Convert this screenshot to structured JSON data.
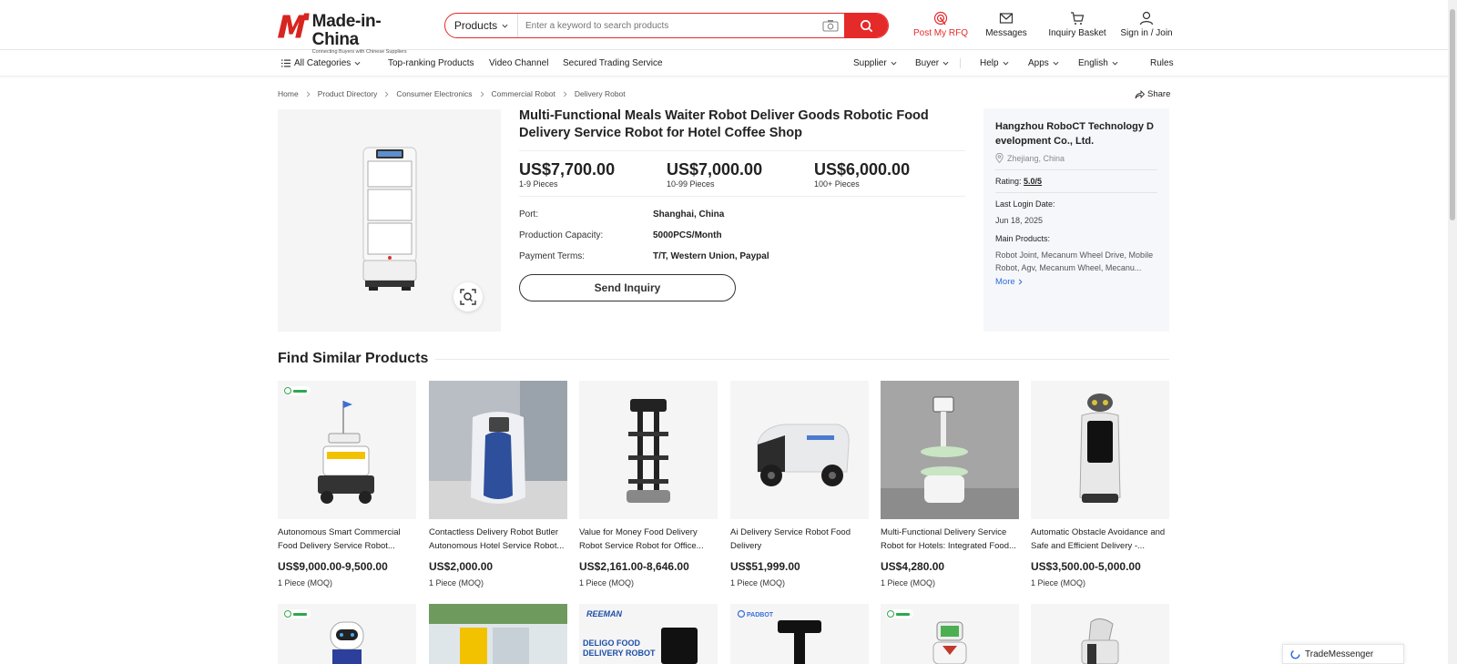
{
  "header": {
    "logo_title": "Made-in-China",
    "logo_subtitle": "Connecting Buyers with Chinese Suppliers",
    "search_category": "Products",
    "search_placeholder": "Enter a keyword to search products",
    "actions": [
      {
        "label": "Post My RFQ",
        "icon": "target-icon"
      },
      {
        "label": "Messages",
        "icon": "mail-icon"
      },
      {
        "label": "Inquiry Basket",
        "icon": "cart-icon"
      },
      {
        "label": "Sign in / Join",
        "icon": "user-icon"
      }
    ],
    "accent_color": "#e52a2a"
  },
  "nav": {
    "all_categories": "All Categories",
    "top_ranking": "Top-ranking Products",
    "video_channel": "Video Channel",
    "secured_trading": "Secured Trading Service",
    "supplier": "Supplier",
    "buyer": "Buyer",
    "help": "Help",
    "apps": "Apps",
    "language": "English",
    "rules": "Rules"
  },
  "breadcrumb": [
    "Home",
    "Product Directory",
    "Consumer Electronics",
    "Commercial Robot",
    "Delivery Robot"
  ],
  "share_label": "Share",
  "product": {
    "title": "Multi-Functional Meals Waiter Robot Deliver Goods Robotic Food Delivery Service Robot for Hotel Coffee Shop",
    "prices": [
      {
        "value": "US$7,700.00",
        "qty": "1-9 Pieces"
      },
      {
        "value": "US$7,000.00",
        "qty": "10-99 Pieces"
      },
      {
        "value": "US$6,000.00",
        "qty": "100+ Pieces"
      }
    ],
    "specs": [
      {
        "label": "Port:",
        "value": "Shanghai, China"
      },
      {
        "label": "Production Capacity:",
        "value": "5000PCS/Month"
      },
      {
        "label": "Payment Terms:",
        "value": "T/T, Western Union, Paypal"
      }
    ],
    "inquiry_label": "Send Inquiry"
  },
  "supplier": {
    "name": "Hangzhou RoboCT Technology Development Co., Ltd.",
    "location": "Zhejiang, China",
    "rating_label": "Rating:",
    "rating_value": "5.0/5",
    "last_login_label": "Last Login Date:",
    "last_login_value": "Jun 18, 2025",
    "main_products_label": "Main Products:",
    "main_products": "Robot Joint, Mecanum Wheel Drive, Mobile Robot, Agv, Mecanum Wheel, Mecanu...",
    "more_label": "More"
  },
  "similar": {
    "title": "Find Similar Products",
    "items": [
      {
        "title": "Autonomous Smart Commercial Food Delivery Service Robot...",
        "price": "US$9,000.00-9,500.00",
        "moq": "1 Piece (MOQ)"
      },
      {
        "title": "Contactless Delivery Robot Butler Autonomous Hotel Service Robot...",
        "price": "US$2,000.00",
        "moq": "1 Piece (MOQ)"
      },
      {
        "title": "Value for Money Food Delivery Robot Service Robot for Office...",
        "price": "US$2,161.00-8,646.00",
        "moq": "1 Piece (MOQ)"
      },
      {
        "title": "Ai Delivery Service Robot Food Delivery",
        "price": "US$51,999.00",
        "moq": "1 Piece (MOQ)"
      },
      {
        "title": "Multi-Functional Delivery Service Robot for Hotels: Integrated Food...",
        "price": "US$4,280.00",
        "moq": "1 Piece (MOQ)"
      },
      {
        "title": "Automatic Obstacle Avoidance and Safe and Efficient Delivery -...",
        "price": "US$3,500.00-5,000.00",
        "moq": "1 Piece (MOQ)"
      }
    ],
    "row2_texts": {
      "reeman": "REEMAN",
      "deligo": "DELIGO FOOD DELIVERY ROBOT",
      "padbot": "PADBOT"
    }
  },
  "messenger_label": "TradeMessenger"
}
